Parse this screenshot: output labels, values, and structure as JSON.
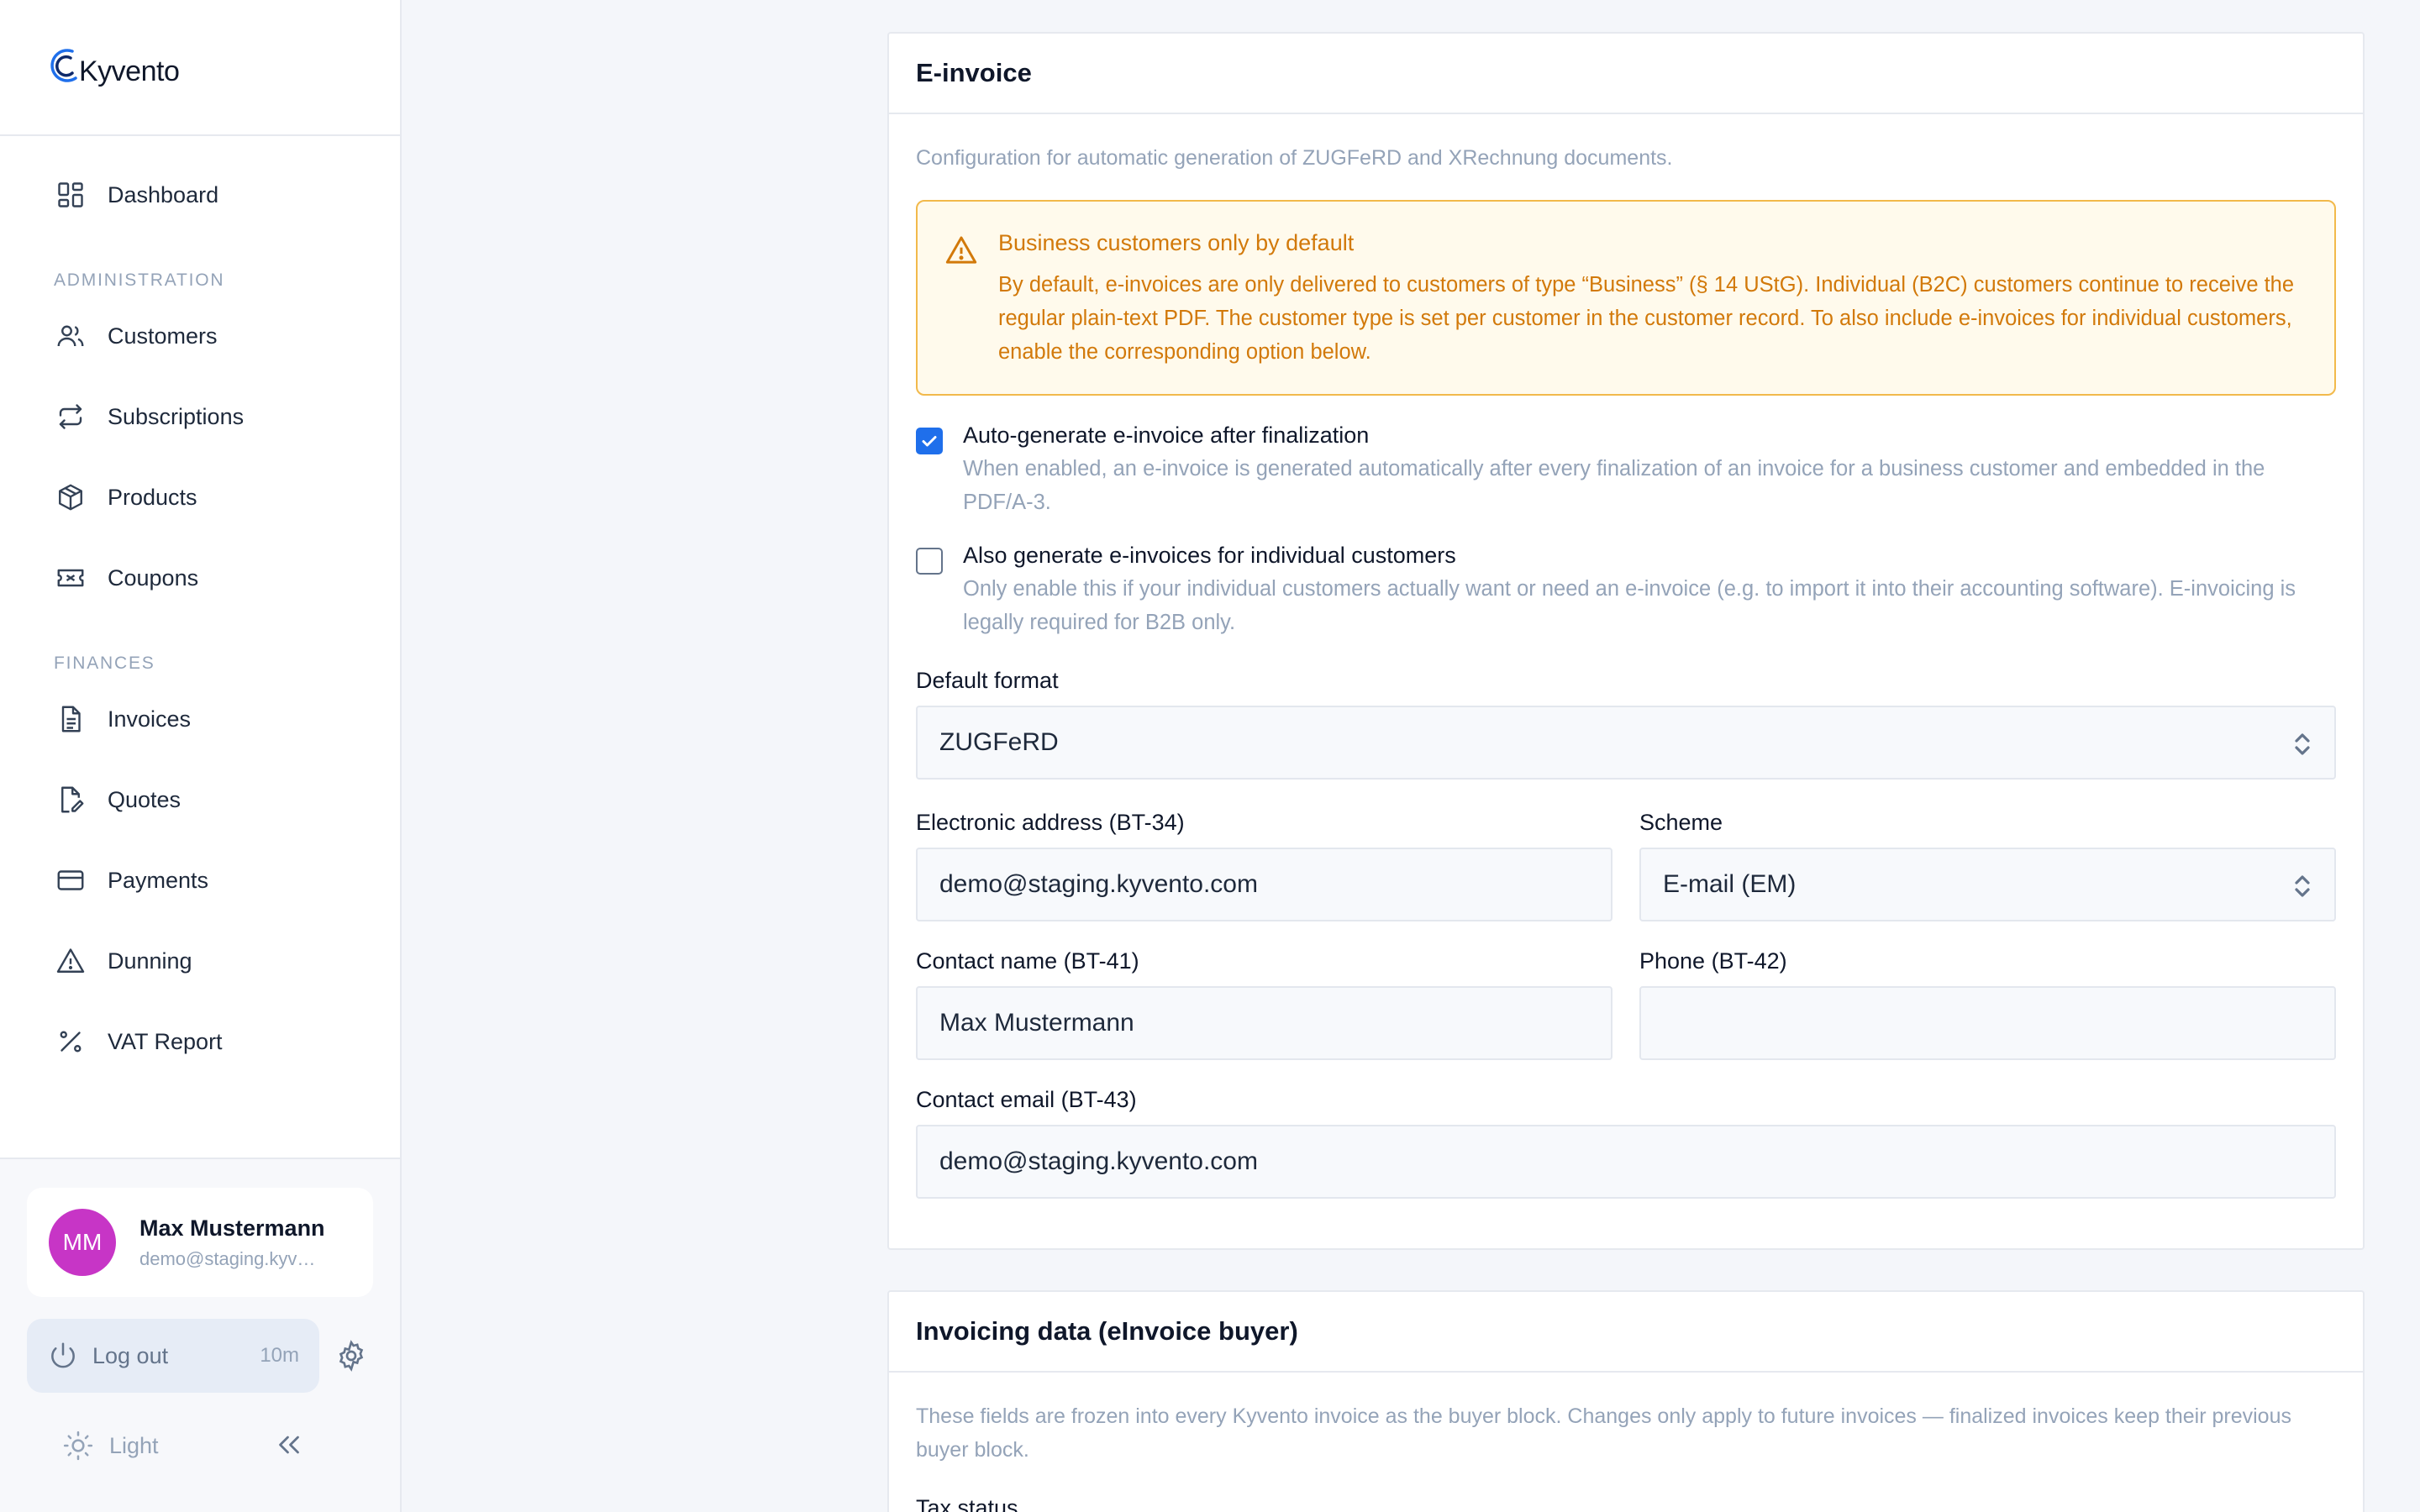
{
  "brand": {
    "name": "Kyvento"
  },
  "sidebar": {
    "top_items": [
      {
        "label": "Dashboard",
        "icon": "dashboard-icon"
      }
    ],
    "sections": [
      {
        "title": "ADMINISTRATION",
        "items": [
          {
            "label": "Customers",
            "icon": "users-icon"
          },
          {
            "label": "Subscriptions",
            "icon": "repeat-icon"
          },
          {
            "label": "Products",
            "icon": "box-icon"
          },
          {
            "label": "Coupons",
            "icon": "ticket-icon"
          }
        ]
      },
      {
        "title": "FINANCES",
        "items": [
          {
            "label": "Invoices",
            "icon": "document-icon"
          },
          {
            "label": "Quotes",
            "icon": "document-edit-icon"
          },
          {
            "label": "Payments",
            "icon": "credit-card-icon"
          },
          {
            "label": "Dunning",
            "icon": "warning-icon"
          },
          {
            "label": "VAT Report",
            "icon": "percent-icon"
          }
        ]
      }
    ]
  },
  "user": {
    "initials": "MM",
    "name": "Max Mustermann",
    "email": "demo@staging.kyvento.com",
    "avatar_color": "#c735c6"
  },
  "footer": {
    "logout_label": "Log out",
    "session_timer": "10m",
    "theme_label": "Light"
  },
  "einvoice": {
    "title": "E-invoice",
    "description": "Configuration for automatic generation of ZUGFeRD and XRechnung documents.",
    "alert": {
      "title": "Business customers only by default",
      "text": "By default, e-invoices are only delivered to customers of type “Business” (§ 14 UStG). Individual (B2C) customers continue to receive the regular plain-text PDF. The customer type is set per customer in the customer record. To also include e-invoices for individual customers, enable the corresponding option below."
    },
    "auto_generate": {
      "checked": true,
      "label": "Auto-generate e-invoice after finalization",
      "help": "When enabled, an e-invoice is generated automatically after every finalization of an invoice for a business customer and embedded in the PDF/A-3."
    },
    "individual": {
      "checked": false,
      "label": "Also generate e-invoices for individual customers",
      "help": "Only enable this if your individual customers actually want or need an e-invoice (e.g. to import it into their accounting software). E-invoicing is legally required for B2B only."
    },
    "default_format": {
      "label": "Default format",
      "value": "ZUGFeRD"
    },
    "electronic_address": {
      "label": "Electronic address (BT-34)",
      "value": "demo@staging.kyvento.com"
    },
    "scheme": {
      "label": "Scheme",
      "value": "E-mail (EM)"
    },
    "contact_name": {
      "label": "Contact name (BT-41)",
      "value": "Max Mustermann"
    },
    "phone": {
      "label": "Phone (BT-42)",
      "value": ""
    },
    "contact_email": {
      "label": "Contact email (BT-43)",
      "value": "demo@staging.kyvento.com"
    }
  },
  "invoicing_data": {
    "title": "Invoicing data (eInvoice buyer)",
    "description": "These fields are frozen into every Kyvento invoice as the buyer block. Changes only apply to future invoices — finalized invoices keep their previous buyer block.",
    "next_label": "Tax status"
  },
  "colors": {
    "accent": "#1f6feb",
    "warning": "#d2790a",
    "warning_bg": "#fffaec"
  }
}
